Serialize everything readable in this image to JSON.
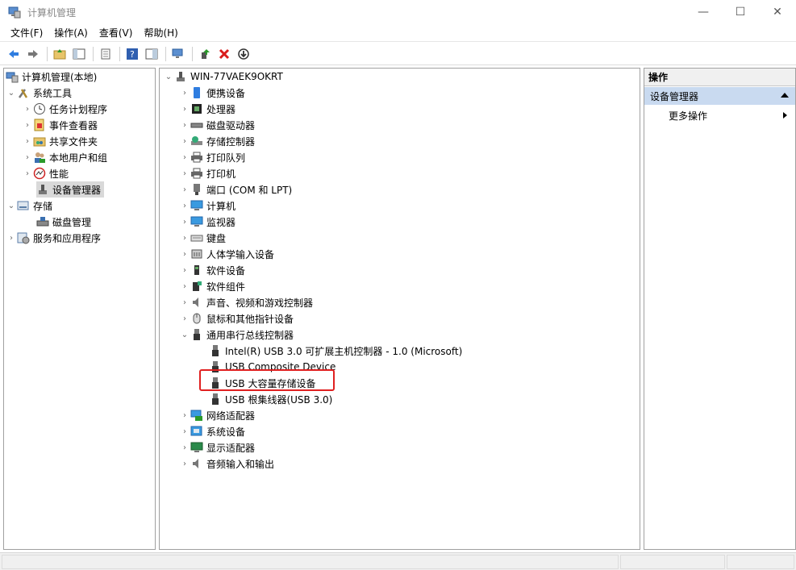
{
  "window": {
    "title": "计算机管理"
  },
  "menu": [
    "文件(F)",
    "操作(A)",
    "查看(V)",
    "帮助(H)"
  ],
  "left_tree": {
    "root": "计算机管理(本地)",
    "system_tools": "系统工具",
    "items": [
      "任务计划程序",
      "事件查看器",
      "共享文件夹",
      "本地用户和组",
      "性能",
      "设备管理器"
    ],
    "storage": "存储",
    "disk_mgmt": "磁盘管理",
    "services": "服务和应用程序"
  },
  "device_tree": {
    "computer": "WIN-77VAEK9OKRT",
    "categories_top": [
      "便携设备",
      "处理器",
      "磁盘驱动器",
      "存储控制器",
      "打印队列",
      "打印机",
      "端口 (COM 和 LPT)",
      "计算机",
      "监视器",
      "键盘",
      "人体学输入设备",
      "软件设备",
      "软件组件",
      "声音、视频和游戏控制器",
      "鼠标和其他指针设备"
    ],
    "usb_category": "通用串行总线控制器",
    "usb_children": [
      "Intel(R) USB 3.0 可扩展主机控制器 - 1.0 (Microsoft)",
      "USB Composite Device",
      "USB 大容量存储设备",
      "USB 根集线器(USB 3.0)"
    ],
    "categories_bottom": [
      "网络适配器",
      "系统设备",
      "显示适配器",
      "音频输入和输出"
    ]
  },
  "actions": {
    "header": "操作",
    "section": "设备管理器",
    "more": "更多操作"
  },
  "colors": {
    "accent_selection": "#c9daf0",
    "highlight_box": "#e02020"
  }
}
